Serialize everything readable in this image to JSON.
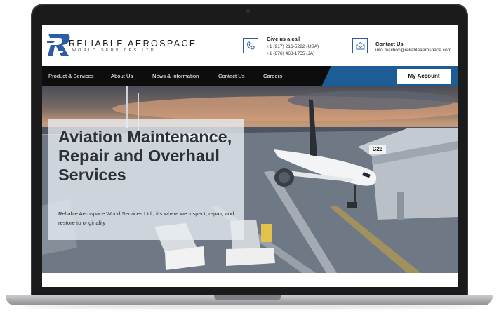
{
  "brand": {
    "name": "RELIABLE AEROSPACE",
    "tagline": "WORLD SERVICES LTD",
    "primary_color": "#2b5da6",
    "dark_color": "#0d0d0d"
  },
  "contact": {
    "phone": {
      "icon": "phone-icon",
      "title": "Give us a call",
      "lines": [
        "+1 (917) 216-5222 (USA)",
        "+1 (876) 468-1755 (JA)"
      ]
    },
    "email": {
      "icon": "mail-icon",
      "title": "Contact Us",
      "line": "info.mailbox@reliableaerospace.com"
    }
  },
  "nav": {
    "items": [
      {
        "label": "Product & Services"
      },
      {
        "label": "About Us"
      },
      {
        "label": "News & Information"
      },
      {
        "label": "Contact Us"
      },
      {
        "label": "Careers"
      }
    ],
    "account_label": "My Account"
  },
  "hero": {
    "title": "Aviation Maintenance, Repair and Overhaul Services",
    "subtitle": "Reliable Aerospace World Services Ltd., it's where we inspect, repair, and restore to originality",
    "gate_sign": "C23"
  }
}
